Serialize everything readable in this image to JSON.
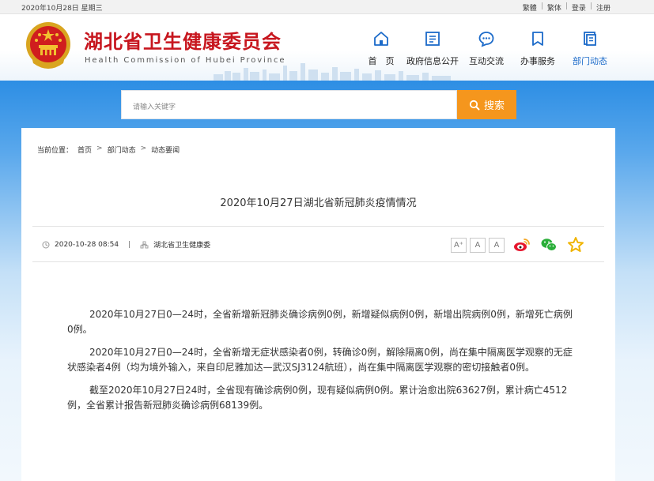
{
  "topbar": {
    "date": "2020年10月28日 星期三",
    "links": [
      "繁體",
      "繁体",
      "登录",
      "注册"
    ]
  },
  "header": {
    "title": "湖北省卫生健康委员会",
    "subtitle": "Health Commission of Hubei Province"
  },
  "nav": [
    {
      "label": "首　页",
      "icon": "home-icon"
    },
    {
      "label": "政府信息公开",
      "icon": "document-icon"
    },
    {
      "label": "互动交流",
      "icon": "chat-icon"
    },
    {
      "label": "办事服务",
      "icon": "bookmark-icon"
    },
    {
      "label": "部门动态",
      "icon": "copy-icon"
    }
  ],
  "search": {
    "placeholder": "请输入关键字",
    "button": "搜索"
  },
  "breadcrumb": {
    "prefix": "当前位置：",
    "items": [
      "首页",
      "部门动态",
      "动态要闻"
    ],
    "arrow": ">"
  },
  "article": {
    "title": "2020年10月27日湖北省新冠肺炎疫情情况",
    "datetime": "2020-10-28 08:54",
    "divider": "|",
    "source": "湖北省卫生健康委",
    "font_buttons": [
      "A⁺",
      "A",
      "A"
    ],
    "paragraphs": [
      "2020年10月27日0—24时，全省新增新冠肺炎确诊病例0例，新增疑似病例0例，新增出院病例0例，新增死亡病例0例。",
      "2020年10月27日0—24时，全省新增无症状感染者0例，转确诊0例，解除隔离0例，尚在集中隔离医学观察的无症状感染者4例（均为境外输入，来自印尼雅加达—武汉SJ3124航班），尚在集中隔离医学观察的密切接触者0例。",
      "截至2020年10月27日24时，全省现有确诊病例0例，现有疑似病例0例。累计治愈出院63627例，累计病亡4512例，全省累计报告新冠肺炎确诊病例68139例。"
    ]
  },
  "colors": {
    "title_red": "#c7161e",
    "nav_active": "#1b6ac9",
    "search_orange": "#f5961d",
    "band_blue": "#2d8ee4"
  }
}
